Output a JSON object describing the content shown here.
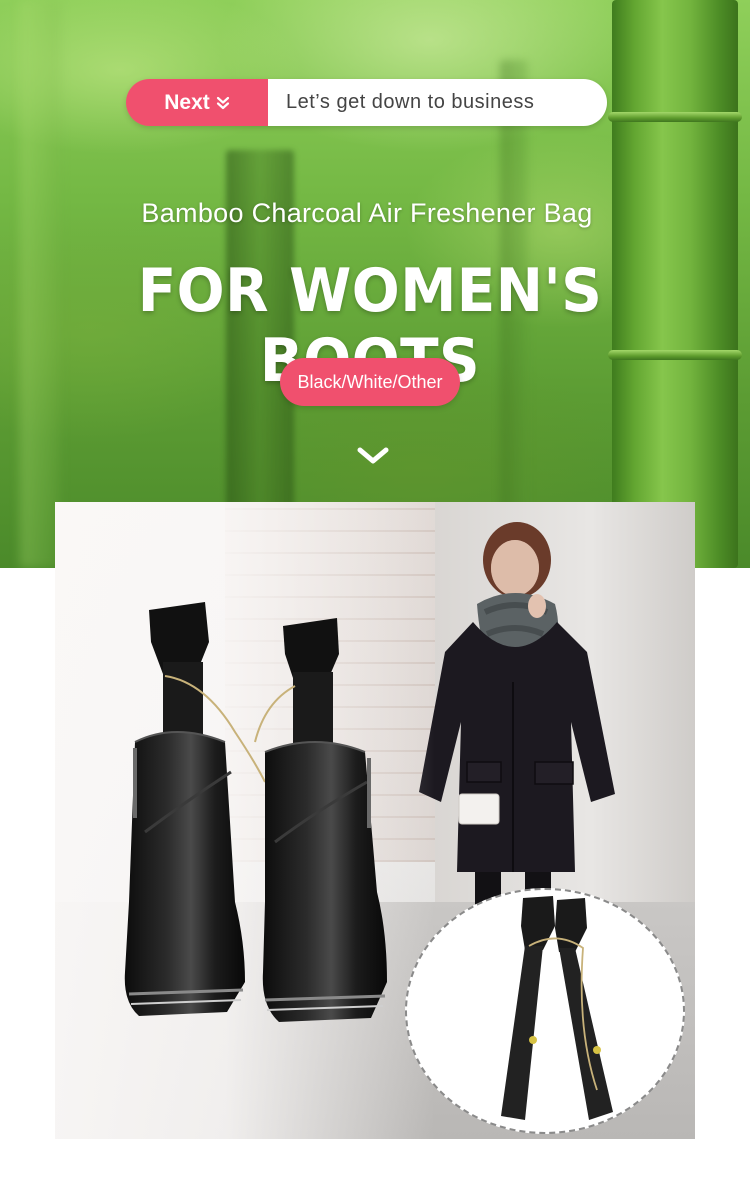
{
  "header_pill": {
    "next_label": "Next",
    "next_icon": "double-chevron-down-icon",
    "tagline": "Let’s get down to business"
  },
  "hero": {
    "subtitle": "Bamboo Charcoal Air Freshener Bag",
    "headline": "FOR WOMEN'S BOOTS",
    "variant_badge": "Black/White/Other",
    "scroll_icon": "chevron-down-icon"
  },
  "colors": {
    "accent_pink": "#f0506e",
    "bamboo_green": "#74b844",
    "text_white": "#ffffff",
    "pill_text": "#444444"
  },
  "photo": {
    "subjects": [
      "black-ankle-boots",
      "woman-in-black-coat",
      "charcoal-bag-pair"
    ]
  }
}
